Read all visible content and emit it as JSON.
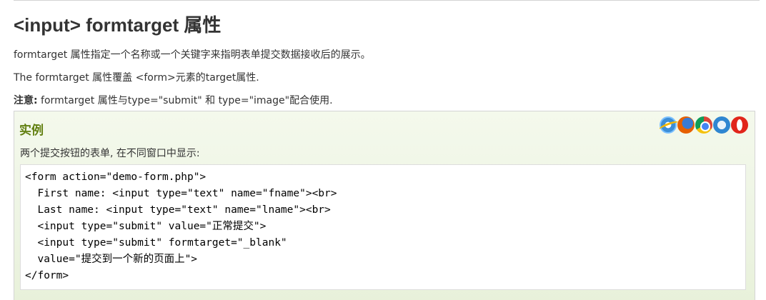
{
  "page": {
    "title": "<input> formtarget 属性",
    "para1": "formtarget 属性指定一个名称或一个关键字来指明表单提交数据接收后的展示。",
    "para2": "The formtarget 属性覆盖 <form>元素的target属性.",
    "note_label": "注意:",
    "note_text": " formtarget 属性与type=\"submit\" 和 type=\"image\"配合使用."
  },
  "example": {
    "title": "实例",
    "description": "两个提交按钮的表单, 在不同窗口中显示:",
    "browser_icons": [
      "ie-icon",
      "firefox-icon",
      "chrome-icon",
      "safari-icon",
      "opera-icon"
    ],
    "code_lines": [
      "<form action=\"demo-form.php\">",
      "  First name: <input type=\"text\" name=\"fname\"><br>",
      "  Last name: <input type=\"text\" name=\"lname\"><br>",
      "  <input type=\"submit\" value=\"正常提交\">",
      "  <input type=\"submit\" formtarget=\"_blank\"",
      "  value=\"提交到一个新的页面上\">",
      "</form>"
    ]
  },
  "colors": {
    "example_title": "#617f10",
    "example_bg": "#edf4e3",
    "text": "#333333"
  }
}
